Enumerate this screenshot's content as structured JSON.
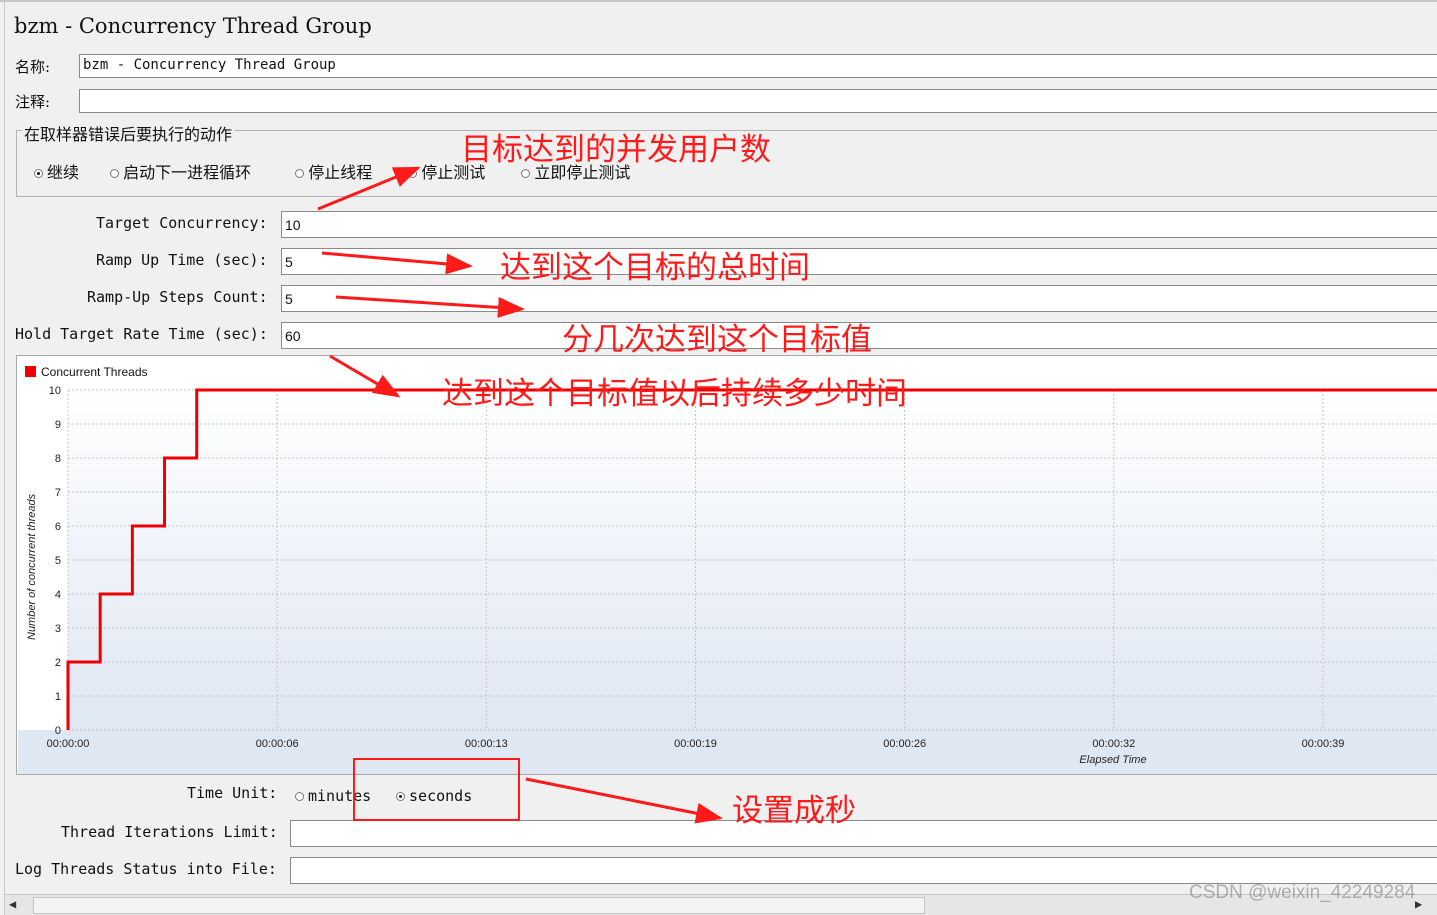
{
  "title": "bzm - Concurrency Thread Group",
  "name": {
    "label": "名称:",
    "value": "bzm - Concurrency Thread Group"
  },
  "comment": {
    "label": "注释:",
    "value": ""
  },
  "sampler_error": {
    "legend": "在取样器错误后要执行的动作",
    "options": [
      "继续",
      "启动下一进程循环",
      "停止线程",
      "停止测试",
      "立即停止测试"
    ],
    "selected": "继续"
  },
  "fields": {
    "target_concurrency": {
      "label": "Target Concurrency:",
      "value": "10"
    },
    "ramp_up_time": {
      "label": "Ramp Up Time (sec):",
      "value": "5"
    },
    "ramp_up_steps": {
      "label": "Ramp-Up Steps Count:",
      "value": "5"
    },
    "hold_time": {
      "label": "Hold Target Rate Time (sec):",
      "value": "60"
    }
  },
  "time_unit": {
    "label": "Time Unit:",
    "options": [
      "minutes",
      "seconds"
    ],
    "selected": "seconds"
  },
  "iterations": {
    "label": "Thread Iterations Limit:",
    "value": ""
  },
  "log_file": {
    "label": "Log Threads Status into File:",
    "value": ""
  },
  "annotations": {
    "a1": "目标达到的并发用户数",
    "a2": "达到这个目标的总时间",
    "a3": "分几次达到这个目标值",
    "a4": "达到这个目标值以后持续多少时间",
    "a5": "设置成秒"
  },
  "watermark": "CSDN @weixin_42249284",
  "colors": {
    "series": "#ee0000",
    "annotation": "#ff1a1a",
    "plot_bg_top": "#ffffff",
    "plot_bg_bottom": "#dfe7f3"
  },
  "chart_data": {
    "type": "line",
    "legend": "Concurrent Threads",
    "ylabel": "Number of concurrent threads",
    "xlabel": "Elapsed Time",
    "ylim": [
      0,
      10
    ],
    "yticks": [
      "0",
      "1",
      "2",
      "3",
      "4",
      "5",
      "6",
      "7",
      "8",
      "9",
      "10"
    ],
    "xtick_labels": [
      "00:00:00",
      "00:00:06",
      "00:00:13",
      "00:00:19",
      "00:00:26",
      "00:00:32",
      "00:00:39"
    ],
    "xtick_seconds": [
      0,
      6.5,
      13,
      19.5,
      26,
      32.5,
      39
    ],
    "xlim": [
      0,
      43
    ],
    "series": [
      {
        "name": "Concurrent Threads",
        "x": [
          0,
          0,
          1,
          1,
          2,
          2,
          3,
          3,
          4,
          4,
          43
        ],
        "y": [
          0,
          2,
          2,
          4,
          4,
          6,
          6,
          8,
          8,
          10,
          10
        ]
      }
    ]
  }
}
